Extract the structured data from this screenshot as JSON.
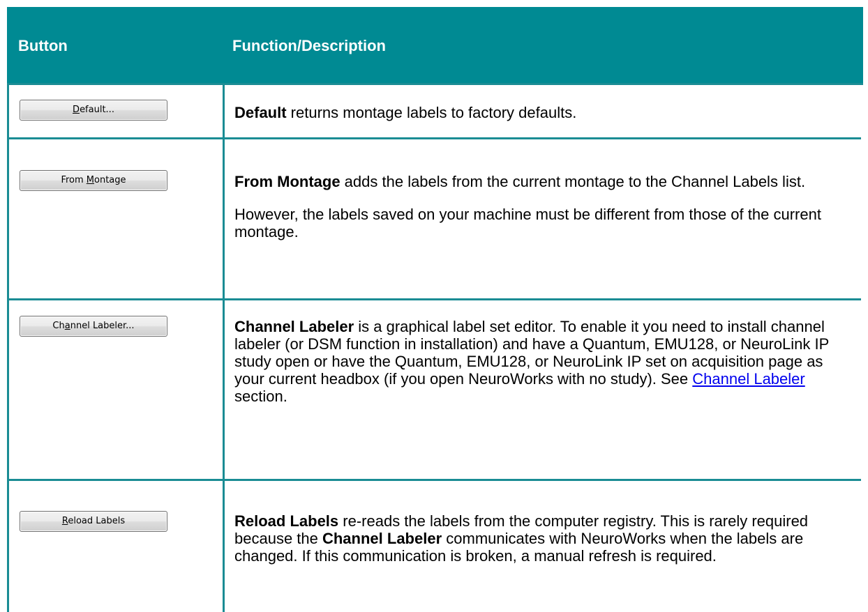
{
  "header": {
    "col1": "Button",
    "col2": "Function/Description"
  },
  "rows": [
    {
      "button": {
        "before": "",
        "mnemonic": "D",
        "after": "efault..."
      },
      "paragraphs": [
        [
          {
            "t": "Default",
            "b": true
          },
          {
            "t": " returns montage labels to factory defaults."
          }
        ]
      ]
    },
    {
      "button": {
        "before": "From ",
        "mnemonic": "M",
        "after": "ontage"
      },
      "paragraphs": [
        [
          {
            "t": "From Montage",
            "b": true
          },
          {
            "t": " adds the labels from the current montage to the Channel Labels list."
          }
        ],
        [
          {
            "t": "However, the labels saved on your machine must be different from those of the current montage."
          }
        ]
      ]
    },
    {
      "button": {
        "before": "Ch",
        "mnemonic": "a",
        "after": "nnel Labeler..."
      },
      "paragraphs": [
        [
          {
            "t": "Channel Labeler",
            "b": true
          },
          {
            "t": " is a graphical label set editor. To enable it you need to install channel labeler (or DSM function in installation) and have a Quantum, EMU128, or NeuroLink IP study open or have  the Quantum, EMU128, or NeuroLink IP set on acquisition page as your current headbox (if you open NeuroWorks with no study). See "
          },
          {
            "t": "Channel Labeler",
            "link": true
          },
          {
            "t": " section."
          }
        ]
      ]
    },
    {
      "button": {
        "before": "",
        "mnemonic": "R",
        "after": "eload Labels"
      },
      "paragraphs": [
        [
          {
            "t": "Reload Labels",
            "b": true
          },
          {
            "t": " re-reads the labels from the computer registry. This is rarely required because the "
          },
          {
            "t": "Channel Labeler",
            "b": true
          },
          {
            "t": " communicates with NeuroWorks when the labels are changed. If this communication is broken, a manual refresh is required."
          }
        ]
      ]
    }
  ],
  "colors": {
    "header_bg": "#008a93",
    "border": "#1a8c94",
    "link": "#0000ee"
  }
}
